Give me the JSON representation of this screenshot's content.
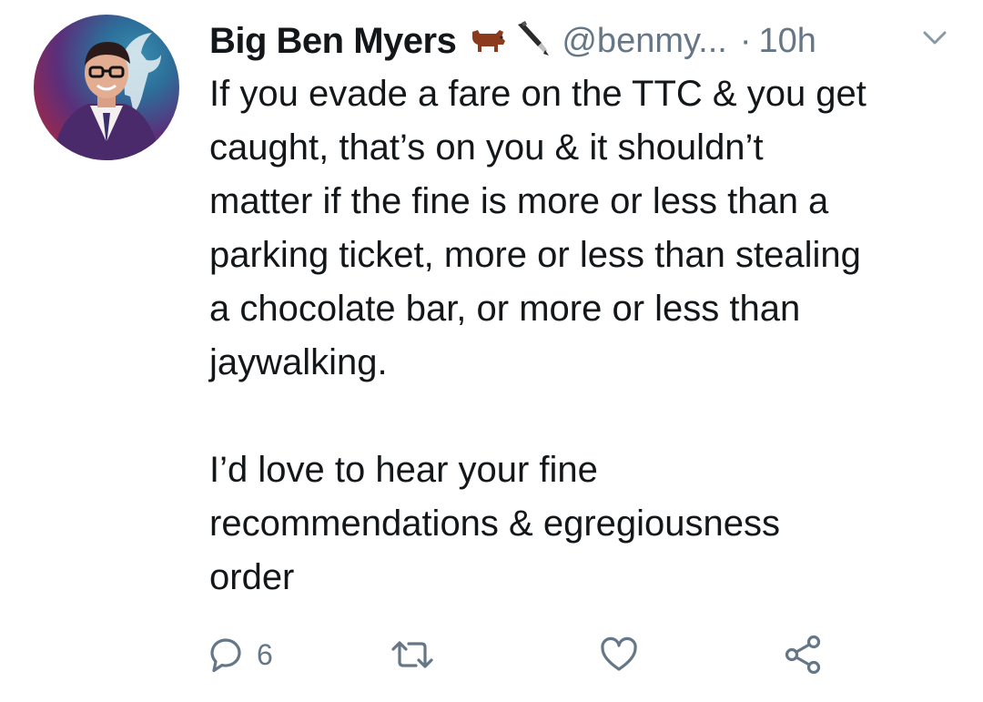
{
  "tweet": {
    "display_name": "Big Ben Myers",
    "badges": [
      "cow-emoji",
      "pen-emoji"
    ],
    "handle": "@benmy...",
    "separator": "·",
    "time": "10h",
    "text": "If you evade a fare on the TTC & you get\ncaught, that’s on you & it shouldn’t\nmatter if the fine is more or less than a\nparking ticket, more or less than stealing\na chocolate bar, or more or less than\njaywalking.\n\nI’d love to hear your fine\nrecommendations & egregiousness\norder",
    "reply_count": "6"
  },
  "icons": {
    "reply": "reply-icon",
    "retweet": "retweet-icon",
    "like": "heart-icon",
    "share": "share-icon",
    "menu": "chevron-down-icon"
  },
  "colors": {
    "text": "#14171a",
    "secondary": "#657786"
  }
}
